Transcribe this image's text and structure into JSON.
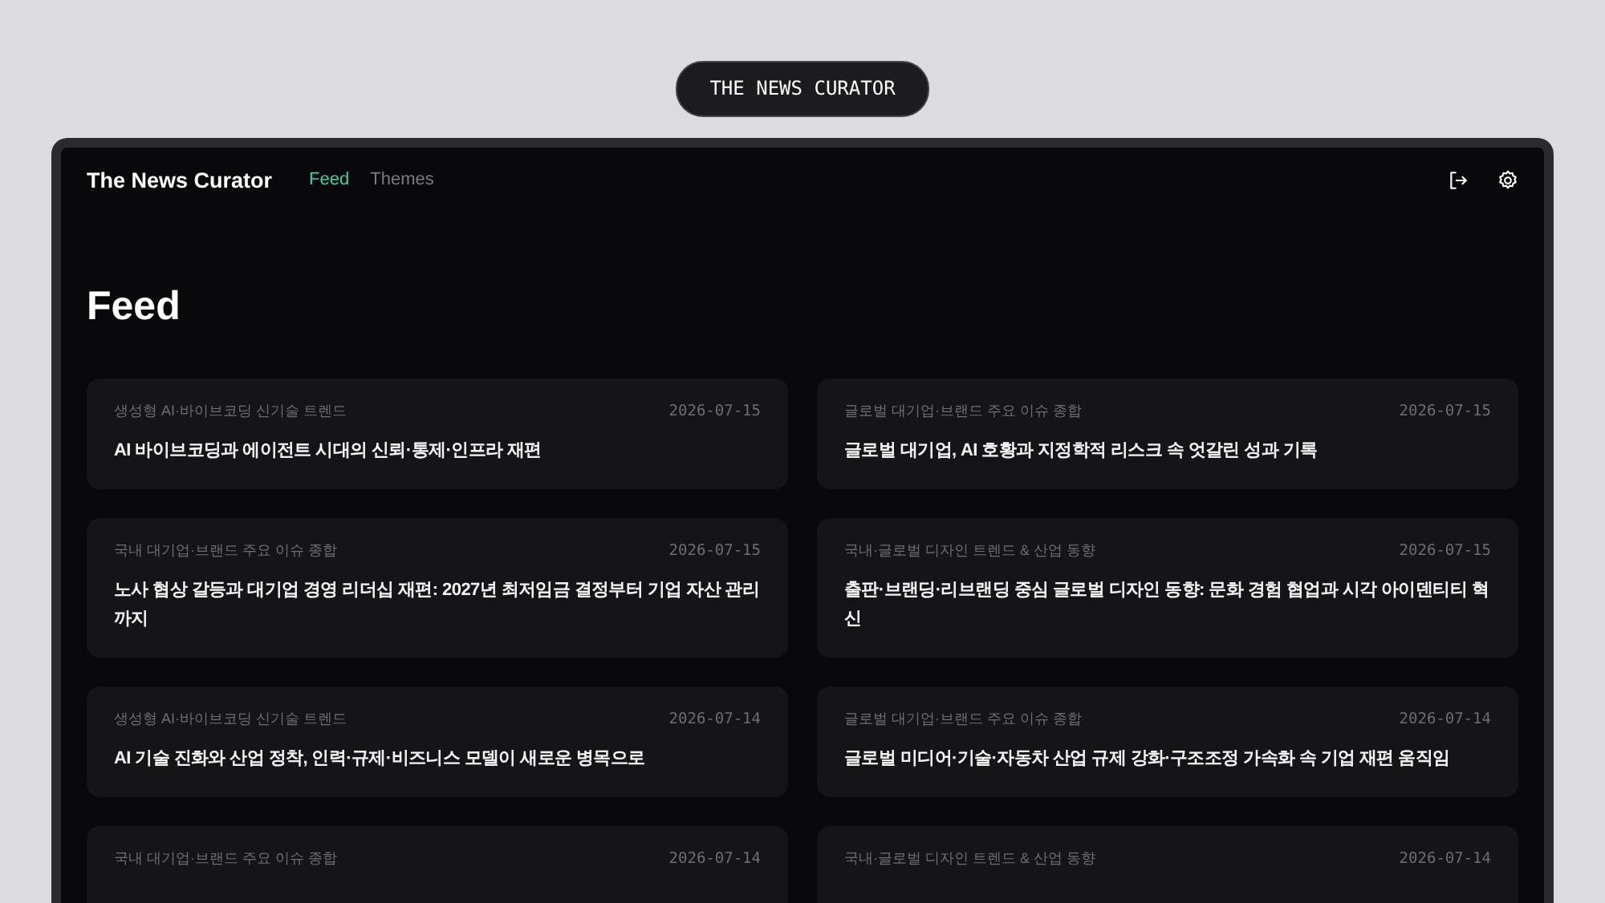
{
  "badge": "THE NEWS CURATOR",
  "app": {
    "title": "The News Curator",
    "nav": [
      {
        "label": "Feed",
        "selected": true
      },
      {
        "label": "Themes",
        "selected": false
      }
    ],
    "heading": "Feed",
    "cards": [
      {
        "category": "생성형 AI·바이브코딩 신기술 트렌드",
        "date": "2026-07-15",
        "title": "AI 바이브코딩과 에이전트 시대의 신뢰·통제·인프라 재편"
      },
      {
        "category": "글로벌 대기업·브랜드 주요 이슈 종합",
        "date": "2026-07-15",
        "title": "글로벌 대기업, AI 호황과 지정학적 리스크 속 엇갈린 성과 기록"
      },
      {
        "category": "국내 대기업·브랜드 주요 이슈 종합",
        "date": "2026-07-15",
        "title": "노사 협상 갈등과 대기업 경영 리더십 재편: 2027년 최저임금 결정부터 기업 자산 관리까지"
      },
      {
        "category": "국내·글로벌 디자인 트렌드 & 산업 동향",
        "date": "2026-07-15",
        "title": "출판·브랜딩·리브랜딩 중심 글로벌 디자인 동향: 문화 경험 협업과 시각 아이덴티티 혁신"
      },
      {
        "category": "생성형 AI·바이브코딩 신기술 트렌드",
        "date": "2026-07-14",
        "title": "AI 기술 진화와 산업 정착, 인력·규제·비즈니스 모델이 새로운 병목으로"
      },
      {
        "category": "글로벌 대기업·브랜드 주요 이슈 종합",
        "date": "2026-07-14",
        "title": "글로벌 미디어·기술·자동차 산업 규제 강화·구조조정 가속화 속 기업 재편 움직임"
      },
      {
        "category": "국내 대기업·브랜드 주요 이슈 종합",
        "date": "2026-07-14"
      },
      {
        "category": "국내·글로벌 디자인 트렌드 & 산업 동향",
        "date": "2026-07-14"
      }
    ]
  }
}
